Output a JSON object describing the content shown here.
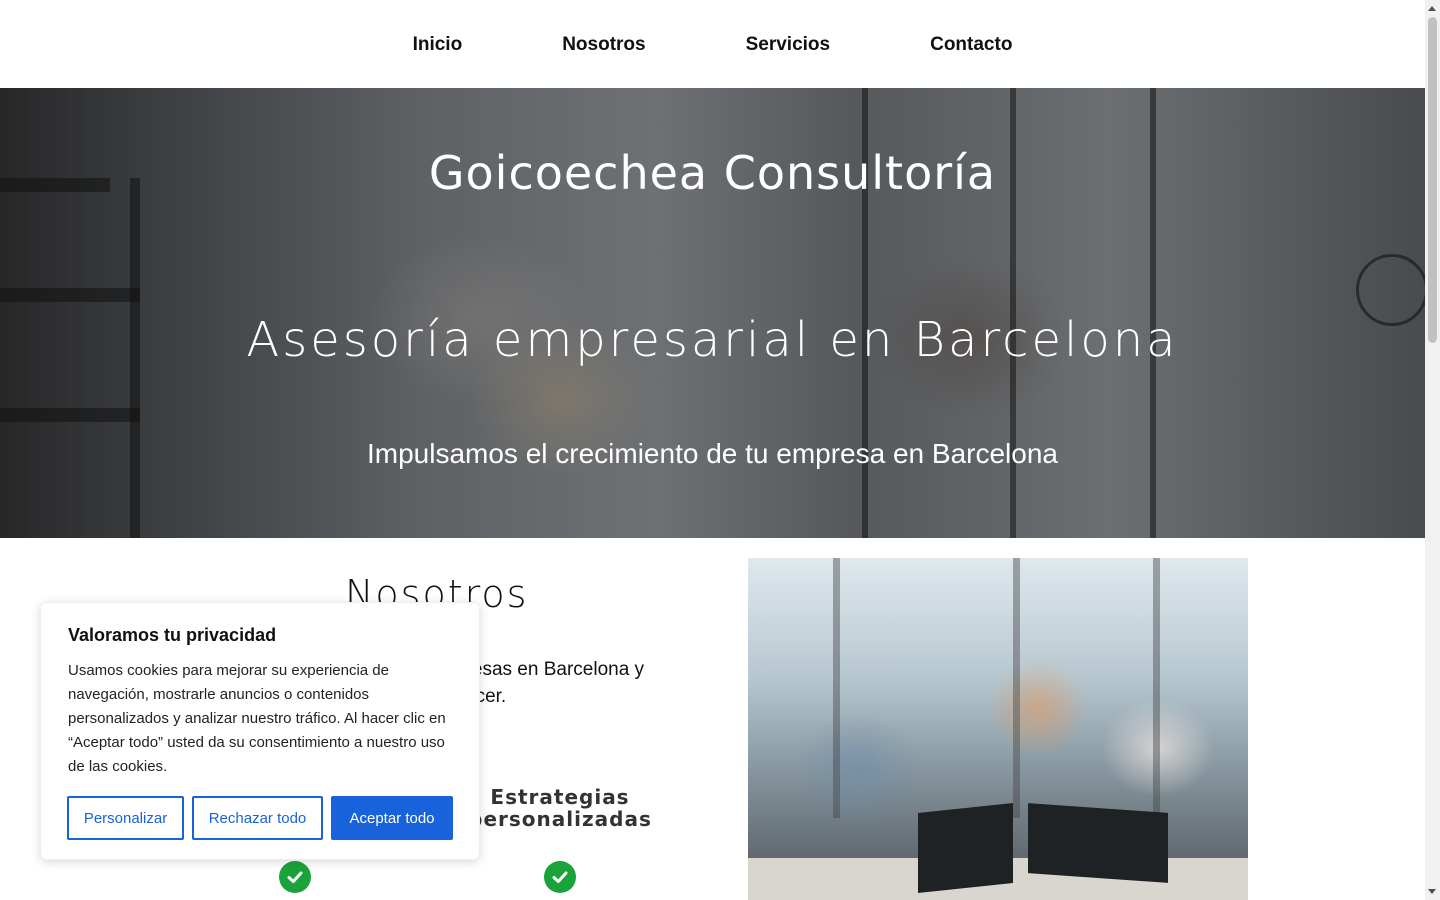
{
  "nav": {
    "items": [
      {
        "label": "Inicio"
      },
      {
        "label": "Nosotros"
      },
      {
        "label": "Servicios"
      },
      {
        "label": "Contacto"
      }
    ]
  },
  "hero": {
    "title": "Goicoechea Consultoría",
    "subtitle": "Asesoría empresarial en Barcelona",
    "tagline": "Impulsamos el crecimiento de tu empresa en Barcelona"
  },
  "about": {
    "title": "Nosotros",
    "text_visible": "presas en Barcelona y ecer.",
    "text_line1": "presas en Barcelona y",
    "text_line2": "ecer.",
    "feature_title_line1": "Estrategias",
    "feature_title_line2": "personalizadas",
    "check_icon": "check-circle-icon",
    "check_color": "#1aa33a"
  },
  "cookie_banner": {
    "title": "Valoramos tu privacidad",
    "body": "Usamos cookies para mejorar su experiencia de navegación, mostrarle anuncios o contenidos personalizados y analizar nuestro tráfico. Al hacer clic en “Aceptar todo” usted da su consentimiento a nuestro uso de las cookies.",
    "buttons": {
      "customize": "Personalizar",
      "reject": "Rechazar todo",
      "accept": "Aceptar todo"
    },
    "accent_color": "#1863dc"
  }
}
